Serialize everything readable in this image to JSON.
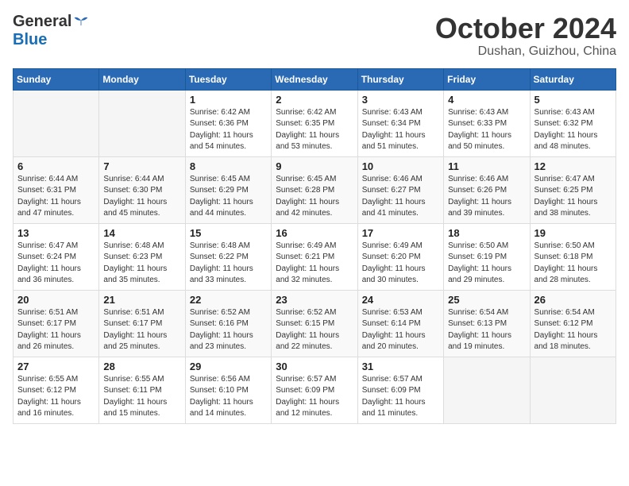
{
  "header": {
    "logo": {
      "general": "General",
      "blue": "Blue",
      "tagline": ""
    },
    "title": "October 2024",
    "location": "Dushan, Guizhou, China"
  },
  "calendar": {
    "days_of_week": [
      "Sunday",
      "Monday",
      "Tuesday",
      "Wednesday",
      "Thursday",
      "Friday",
      "Saturday"
    ],
    "weeks": [
      [
        {
          "day": "",
          "info": ""
        },
        {
          "day": "",
          "info": ""
        },
        {
          "day": "1",
          "info": "Sunrise: 6:42 AM\nSunset: 6:36 PM\nDaylight: 11 hours\nand 54 minutes."
        },
        {
          "day": "2",
          "info": "Sunrise: 6:42 AM\nSunset: 6:35 PM\nDaylight: 11 hours\nand 53 minutes."
        },
        {
          "day": "3",
          "info": "Sunrise: 6:43 AM\nSunset: 6:34 PM\nDaylight: 11 hours\nand 51 minutes."
        },
        {
          "day": "4",
          "info": "Sunrise: 6:43 AM\nSunset: 6:33 PM\nDaylight: 11 hours\nand 50 minutes."
        },
        {
          "day": "5",
          "info": "Sunrise: 6:43 AM\nSunset: 6:32 PM\nDaylight: 11 hours\nand 48 minutes."
        }
      ],
      [
        {
          "day": "6",
          "info": "Sunrise: 6:44 AM\nSunset: 6:31 PM\nDaylight: 11 hours\nand 47 minutes."
        },
        {
          "day": "7",
          "info": "Sunrise: 6:44 AM\nSunset: 6:30 PM\nDaylight: 11 hours\nand 45 minutes."
        },
        {
          "day": "8",
          "info": "Sunrise: 6:45 AM\nSunset: 6:29 PM\nDaylight: 11 hours\nand 44 minutes."
        },
        {
          "day": "9",
          "info": "Sunrise: 6:45 AM\nSunset: 6:28 PM\nDaylight: 11 hours\nand 42 minutes."
        },
        {
          "day": "10",
          "info": "Sunrise: 6:46 AM\nSunset: 6:27 PM\nDaylight: 11 hours\nand 41 minutes."
        },
        {
          "day": "11",
          "info": "Sunrise: 6:46 AM\nSunset: 6:26 PM\nDaylight: 11 hours\nand 39 minutes."
        },
        {
          "day": "12",
          "info": "Sunrise: 6:47 AM\nSunset: 6:25 PM\nDaylight: 11 hours\nand 38 minutes."
        }
      ],
      [
        {
          "day": "13",
          "info": "Sunrise: 6:47 AM\nSunset: 6:24 PM\nDaylight: 11 hours\nand 36 minutes."
        },
        {
          "day": "14",
          "info": "Sunrise: 6:48 AM\nSunset: 6:23 PM\nDaylight: 11 hours\nand 35 minutes."
        },
        {
          "day": "15",
          "info": "Sunrise: 6:48 AM\nSunset: 6:22 PM\nDaylight: 11 hours\nand 33 minutes."
        },
        {
          "day": "16",
          "info": "Sunrise: 6:49 AM\nSunset: 6:21 PM\nDaylight: 11 hours\nand 32 minutes."
        },
        {
          "day": "17",
          "info": "Sunrise: 6:49 AM\nSunset: 6:20 PM\nDaylight: 11 hours\nand 30 minutes."
        },
        {
          "day": "18",
          "info": "Sunrise: 6:50 AM\nSunset: 6:19 PM\nDaylight: 11 hours\nand 29 minutes."
        },
        {
          "day": "19",
          "info": "Sunrise: 6:50 AM\nSunset: 6:18 PM\nDaylight: 11 hours\nand 28 minutes."
        }
      ],
      [
        {
          "day": "20",
          "info": "Sunrise: 6:51 AM\nSunset: 6:17 PM\nDaylight: 11 hours\nand 26 minutes."
        },
        {
          "day": "21",
          "info": "Sunrise: 6:51 AM\nSunset: 6:17 PM\nDaylight: 11 hours\nand 25 minutes."
        },
        {
          "day": "22",
          "info": "Sunrise: 6:52 AM\nSunset: 6:16 PM\nDaylight: 11 hours\nand 23 minutes."
        },
        {
          "day": "23",
          "info": "Sunrise: 6:52 AM\nSunset: 6:15 PM\nDaylight: 11 hours\nand 22 minutes."
        },
        {
          "day": "24",
          "info": "Sunrise: 6:53 AM\nSunset: 6:14 PM\nDaylight: 11 hours\nand 20 minutes."
        },
        {
          "day": "25",
          "info": "Sunrise: 6:54 AM\nSunset: 6:13 PM\nDaylight: 11 hours\nand 19 minutes."
        },
        {
          "day": "26",
          "info": "Sunrise: 6:54 AM\nSunset: 6:12 PM\nDaylight: 11 hours\nand 18 minutes."
        }
      ],
      [
        {
          "day": "27",
          "info": "Sunrise: 6:55 AM\nSunset: 6:12 PM\nDaylight: 11 hours\nand 16 minutes."
        },
        {
          "day": "28",
          "info": "Sunrise: 6:55 AM\nSunset: 6:11 PM\nDaylight: 11 hours\nand 15 minutes."
        },
        {
          "day": "29",
          "info": "Sunrise: 6:56 AM\nSunset: 6:10 PM\nDaylight: 11 hours\nand 14 minutes."
        },
        {
          "day": "30",
          "info": "Sunrise: 6:57 AM\nSunset: 6:09 PM\nDaylight: 11 hours\nand 12 minutes."
        },
        {
          "day": "31",
          "info": "Sunrise: 6:57 AM\nSunset: 6:09 PM\nDaylight: 11 hours\nand 11 minutes."
        },
        {
          "day": "",
          "info": ""
        },
        {
          "day": "",
          "info": ""
        }
      ]
    ]
  }
}
